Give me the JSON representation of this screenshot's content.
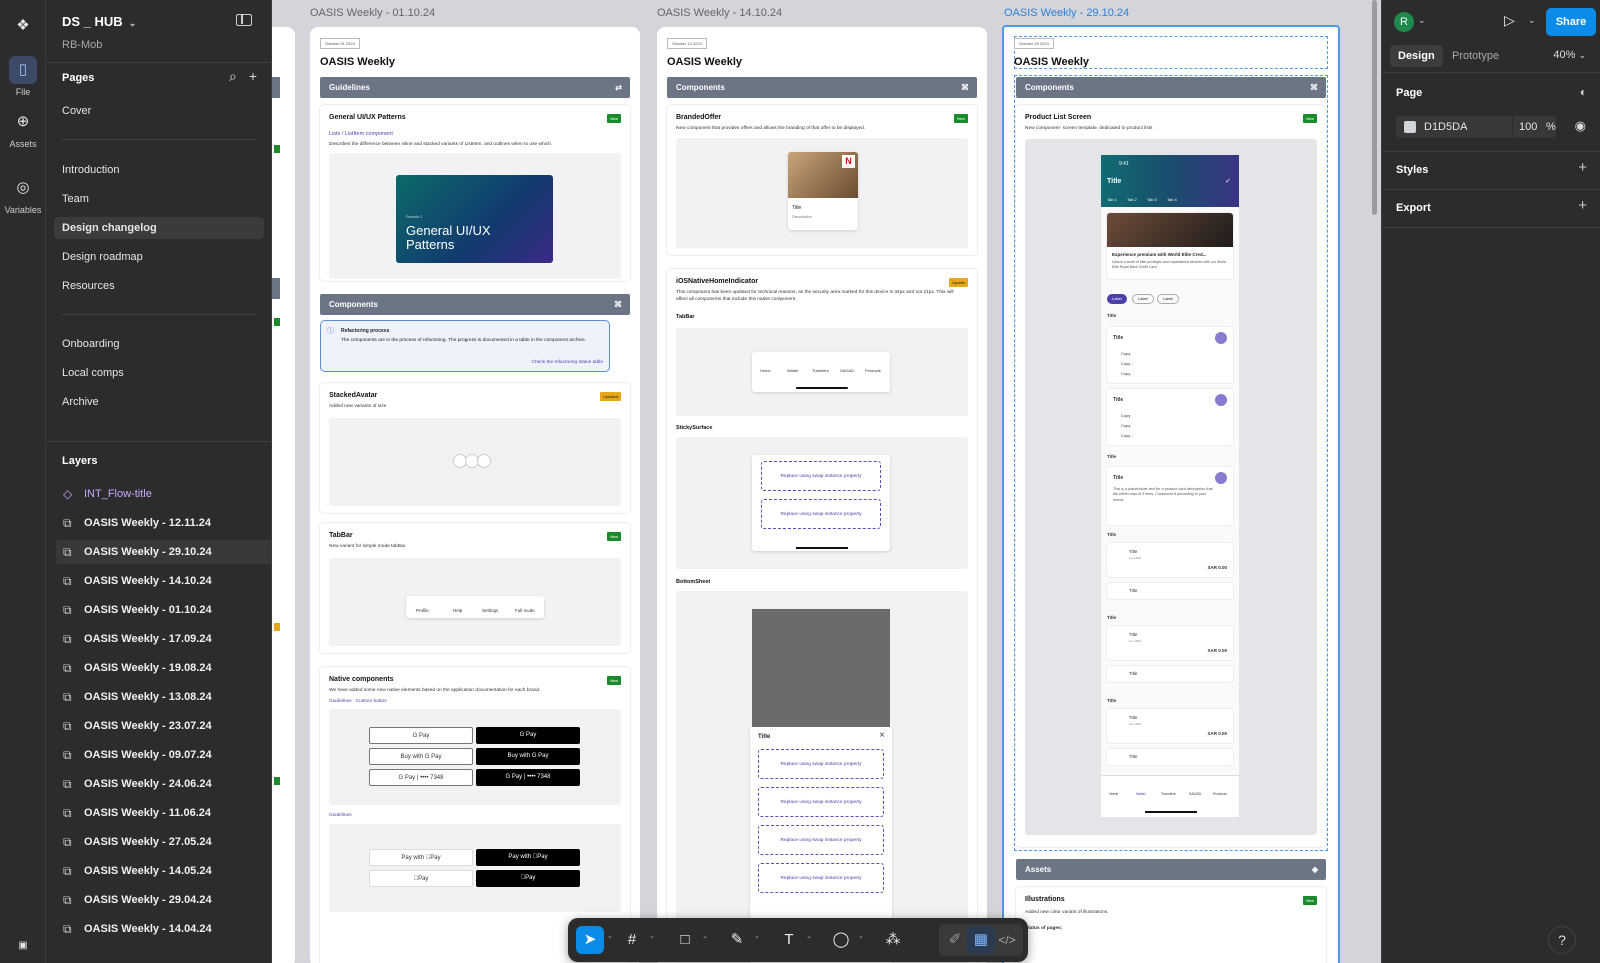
{
  "left_panel": {
    "file_name": "DS _ HUB",
    "sub": "RB-Mob",
    "pages_header": "Pages",
    "pages": [
      "Cover",
      "Introduction",
      "Team",
      "Design changelog",
      "Design roadmap",
      "Resources",
      "Onboarding",
      "Local comps",
      "Archive"
    ],
    "selected_page": "Design changelog",
    "layers_header": "Layers",
    "layers": [
      "INT_Flow-title",
      "OASIS Weekly - 12.11.24",
      "OASIS Weekly - 29.10.24",
      "OASIS Weekly - 14.10.24",
      "OASIS Weekly - 01.10.24",
      "OASIS Weekly - 17.09.24",
      "OASIS Weekly - 19.08.24",
      "OASIS Weekly - 13.08.24",
      "OASIS Weekly - 23.07.24",
      "OASIS Weekly - 09.07.24",
      "OASIS Weekly - 24.06.24",
      "OASIS Weekly - 11.06.24",
      "OASIS Weekly - 27.05.24",
      "OASIS Weekly - 14.05.24",
      "OASIS Weekly - 29.04.24",
      "OASIS Weekly - 14.04.24"
    ],
    "selected_layer": "OASIS Weekly - 29.10.24"
  },
  "rail": {
    "file": "File",
    "assets": "Assets",
    "variables": "Variables"
  },
  "right_panel": {
    "avatar": "R",
    "share": "Share",
    "tabs": [
      "Design",
      "Prototype"
    ],
    "zoom": "40%",
    "page_header": "Page",
    "fill_hex": "D1D5DA",
    "fill_opacity": "100",
    "percent": "%",
    "styles": "Styles",
    "export": "Export"
  },
  "frames": [
    {
      "title": "OASIS Weekly - 01.10.24",
      "date": "October 01 2024",
      "heading": "OASIS Weekly",
      "guidelines_bar": "Guidelines",
      "general": {
        "title": "General UI/UX Patterns",
        "link": "Lists / ListItem component",
        "desc": "Describes the difference between inline and stacked variants of ListItem, and outlines when to use which.",
        "badge": "New",
        "cover_small": "Formula 3",
        "cover_title": "General UI/UX Patterns"
      },
      "components_bar": "Components",
      "info": {
        "title": "Refactoring process",
        "text": "The components are in the process of refactoring. The progress is documented in a table in the component archive.",
        "link": "Check the refactoring status table"
      },
      "stacked": {
        "title": "StackedAvatar",
        "desc": "Added new variants of size",
        "badge": "Updated"
      },
      "tabbar": {
        "title": "TabBar",
        "desc": "New variant for simple mode tabBar.",
        "badge": "New",
        "items": [
          "Profile",
          "Help",
          "Settings",
          "Full mode"
        ]
      },
      "native": {
        "title": "Native components",
        "desc": "We have added some new native elements based on the application documentation for each brand.",
        "badge": "New",
        "links": [
          "Guidelines",
          "Custom button"
        ],
        "gpay": [
          "G Pay",
          "G Pay",
          "Buy with G Pay",
          "Buy with G Pay",
          "G Pay | •••• 7348",
          "G Pay | •••• 7348"
        ],
        "guidelines2": "Guidelines",
        "apay": [
          "Pay with Pay",
          "Pay with Pay",
          "Pay",
          "Pay"
        ]
      }
    },
    {
      "title": "OASIS Weekly - 14.10.24",
      "date": "October 14 2024",
      "heading": "OASIS Weekly",
      "components_bar": "Components",
      "branded": {
        "title": "BrandedOffer",
        "desc": "New component that provides offers and allows the branding of that offer to be displayed.",
        "badge": "New",
        "card_title": "Title",
        "card_desc": "Description"
      },
      "ios": {
        "title": "iOSNativeHomeIndicator",
        "desc": "This component has been updated for technical reasons, as the security area marked for this device is 34px and not 21px. This will affect all components that include this native component.",
        "badge": "Update",
        "sub": "TabBar",
        "tabs": [
          "Home",
          "Wallet",
          "Transfers",
          "SADAD",
          "Products"
        ]
      },
      "sticky": {
        "title": "StickySurface",
        "swap": "Replace using swap instance property"
      },
      "bottomsheet": {
        "title": "BottomSheet",
        "sheet_title": "Title",
        "swap": "Replace using swap instance property"
      }
    },
    {
      "title": "OASIS Weekly - 29.10.24",
      "date": "October 29 2024",
      "heading": "OASIS Weekly",
      "components_bar": "Components",
      "product": {
        "title": "Product List Screen",
        "desc": "New component- screen template, dedicated to product lists",
        "badge": "New"
      },
      "phone": {
        "time": "9:41",
        "title": "Title",
        "tabs": [
          "Tab 1",
          "Tab 2",
          "Tab 3",
          "Tab 4"
        ],
        "promo_title": "Experience premium with World Elite Cred...",
        "promo_desc": "Unlock a world of elite privileges and unparalleled services with our World Elite Riyad Bank Credit Card.",
        "chips": [
          "Label",
          "Label",
          "Label"
        ],
        "section": "Title",
        "card_title": "Title",
        "copy": "Copy",
        "placeholder": "This is a placeholder text for a product card description that fits within max of 3 lines. Customize it according to your needs.",
        "acct_title": "Title",
        "acct_num": "•••• 1234",
        "amount": "SAR 0.00",
        "add": "Title",
        "tabbar": [
          "Home",
          "Wallet",
          "Transfers",
          "SADAD",
          "Products"
        ]
      },
      "assets_bar": "Assets",
      "illus": {
        "title": "Illustrations",
        "desc": "Added new color variant of illustrations.",
        "status": "Status of pages:",
        "badge": "New"
      }
    }
  ]
}
